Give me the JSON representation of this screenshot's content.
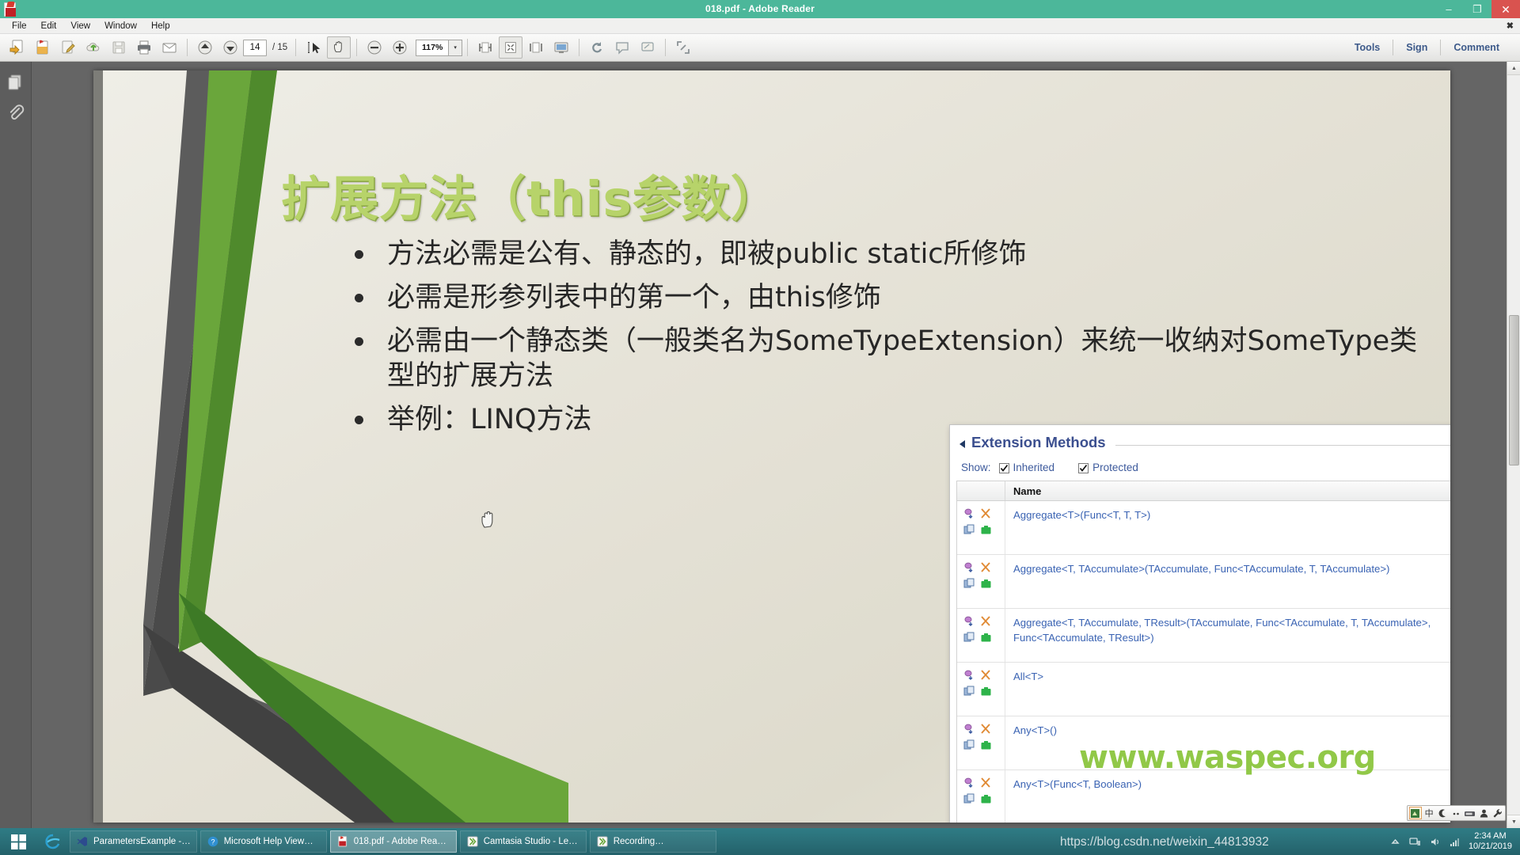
{
  "window": {
    "title": "018.pdf - Adobe Reader",
    "app_icon": "adobe-pdf-icon",
    "minimize": "–",
    "maximize": "❐",
    "close": "✕"
  },
  "menubar": {
    "items": [
      "File",
      "Edit",
      "View",
      "Window",
      "Help"
    ],
    "close_label": "✖"
  },
  "toolbar": {
    "icons": [
      "open-file-icon",
      "create-pdf-icon",
      "edit-pdf-icon",
      "cloud-upload-icon",
      "save-icon",
      "print-icon",
      "email-icon",
      "previous-page-icon",
      "next-page-icon",
      "select-tool-icon",
      "hand-tool-icon",
      "zoom-out-icon",
      "zoom-in-icon",
      "fit-width-icon",
      "fit-page-icon",
      "fit-visible-icon",
      "read-mode-icon",
      "rotate-icon",
      "comment-bubble-icon",
      "highlight-icon",
      "fullscreen-icon"
    ],
    "page_current": "14",
    "page_total": "/ 15",
    "zoom_value": "117%",
    "zoom_dropdown": "▾",
    "right_links": [
      "Tools",
      "Sign",
      "Comment"
    ]
  },
  "navpane": {
    "items": [
      "page-thumbnails-icon",
      "attachments-icon"
    ]
  },
  "scrollbar": {
    "up": "▲",
    "down": "▼"
  },
  "slide": {
    "title": "扩展方法（this参数）",
    "bullets": [
      "方法必需是公有、静态的，即被public static所修饰",
      "必需是形参列表中的第一个，由this修饰",
      "必需由一个静态类（一般类名为SomeTypeExtension）来统一收纳对SomeType类型的扩展方法",
      "举例：LINQ方法"
    ],
    "watermark": "www.waspec.org",
    "title_color": "#b7d36a"
  },
  "extension_panel": {
    "title": "Extension Methods",
    "collapse_icon": "triangle-collapse-icon",
    "show_label": "Show:",
    "checkboxes": [
      {
        "label": "Inherited",
        "checked": true
      },
      {
        "label": "Protected",
        "checked": true
      }
    ],
    "columns": [
      "",
      "Name"
    ],
    "row_icons": [
      "method-icon",
      "extension-icon",
      "overload-icon",
      "briefcase-icon"
    ],
    "rows": [
      {
        "name": "Aggregate<T>(Func<T, T, T>)"
      },
      {
        "name": "Aggregate<T, TAccumulate>(TAccumulate, Func<TAccumulate, T, TAccumulate>)"
      },
      {
        "name": "Aggregate<T, TAccumulate, TResult>(TAccumulate, Func<TAccumulate, T, TAccumulate>, Func<TAccumulate, TResult>)"
      },
      {
        "name": "All<T>"
      },
      {
        "name": "Any<T>()"
      },
      {
        "name": "Any<T>(Func<T, Boolean>)"
      }
    ]
  },
  "ime": {
    "items": [
      "ime-logo-icon",
      "中",
      "moon-icon",
      "punctuation-icon",
      "keyboard-icon",
      "user-icon",
      "tools-icon"
    ]
  },
  "taskbar": {
    "start_icon": "windows-start-icon",
    "ie_icon": "internet-explorer-icon",
    "items": [
      {
        "label": "ParametersExample -…",
        "icon": "visual-studio-icon",
        "active": false
      },
      {
        "label": "Microsoft Help View…",
        "icon": "help-viewer-icon",
        "active": false
      },
      {
        "label": "018.pdf - Adobe Rea…",
        "icon": "adobe-pdf-icon",
        "active": true
      },
      {
        "label": "Camtasia Studio - Le…",
        "icon": "camtasia-icon",
        "active": false
      },
      {
        "label": "Recording…",
        "icon": "camtasia-recorder-icon",
        "active": false
      }
    ],
    "tray": [
      "show-hidden-icon",
      "network-icon",
      "volume-icon",
      "signal-icon"
    ],
    "clock_time": "2:34 AM",
    "clock_date": "10/21/2019"
  },
  "overlay": {
    "csdn_url": "https://blog.csdn.net/weixin_44813932"
  }
}
